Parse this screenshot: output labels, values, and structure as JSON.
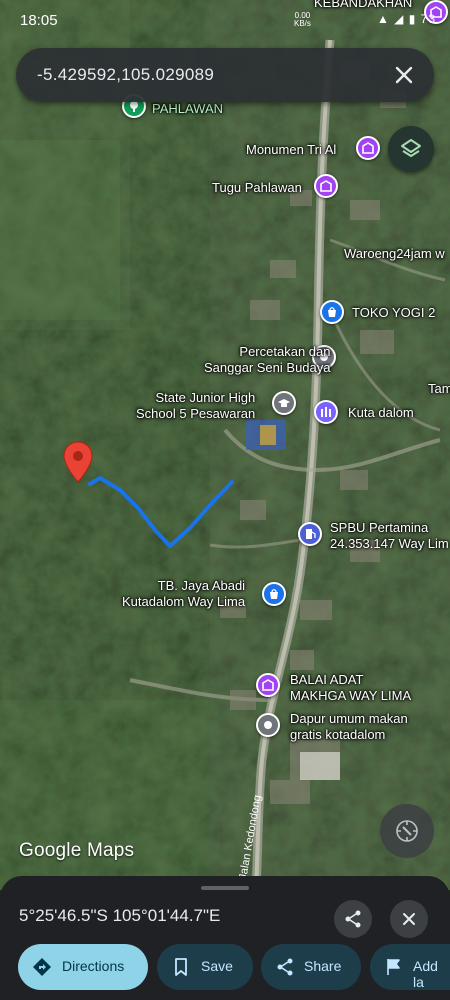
{
  "status": {
    "time": "18:05",
    "net_line1": "0.00",
    "net_line2": "KB/s",
    "icons": "▲ ◢ ▮ 73"
  },
  "search": {
    "query": "-5.429592,105.029089"
  },
  "map": {
    "places": [
      {
        "id": "kebandakhan",
        "label": "KEBANDAKHAN",
        "color": "#a142f4"
      },
      {
        "id": "pahlawan",
        "label": "PAHLAWAN",
        "color": "#0f9d58"
      },
      {
        "id": "monumen",
        "label": "Monumen Tri Al",
        "color": "#a142f4"
      },
      {
        "id": "tugu",
        "label": "Tugu Pahlawan",
        "color": "#a142f4"
      },
      {
        "id": "waroeng",
        "label": "Waroeng24jam w",
        "color": "#a142f4"
      },
      {
        "id": "toko-yogi",
        "label": "TOKO YOGI 2",
        "color": "#1a73e8"
      },
      {
        "id": "percetakan",
        "label": "Percetakan dan\nSanggar Seni Budaya",
        "color": "#70757a"
      },
      {
        "id": "tam",
        "label": "Tam",
        "color": "#70757a"
      },
      {
        "id": "school",
        "label": "State Junior High\nSchool 5 Pesawaran",
        "color": "#70757a"
      },
      {
        "id": "kuta-dalom",
        "label": "Kuta dalom",
        "color": "#7b61ff"
      },
      {
        "id": "spbu",
        "label": "SPBU Pertamina\n24.353.147 Way Lim",
        "color": "#4c5fd5"
      },
      {
        "id": "tb-jaya",
        "label": "TB. Jaya Abadi\nKutadalom Way Lima",
        "color": "#1a73e8"
      },
      {
        "id": "balai",
        "label": "BALAI ADAT\nMAKHGA WAY LIMA",
        "color": "#a142f4"
      },
      {
        "id": "dapur",
        "label": "Dapur umum makan\ngratis kotadalom",
        "color": "#70757a"
      }
    ],
    "road_label": "Jalan Kedondong",
    "attribution": "Google Maps",
    "marker_color": "#ea4335",
    "route_color": "#1a73e8"
  },
  "sheet": {
    "coordinates": "5°25'46.5\"S 105°01'44.7\"E",
    "actions": [
      {
        "id": "directions",
        "label": "Directions",
        "icon": "directions-icon"
      },
      {
        "id": "save",
        "label": "Save",
        "icon": "bookmark-icon"
      },
      {
        "id": "share",
        "label": "Share",
        "icon": "share-icon"
      },
      {
        "id": "add-label",
        "label": "Add la",
        "icon": "flag-icon"
      }
    ]
  }
}
